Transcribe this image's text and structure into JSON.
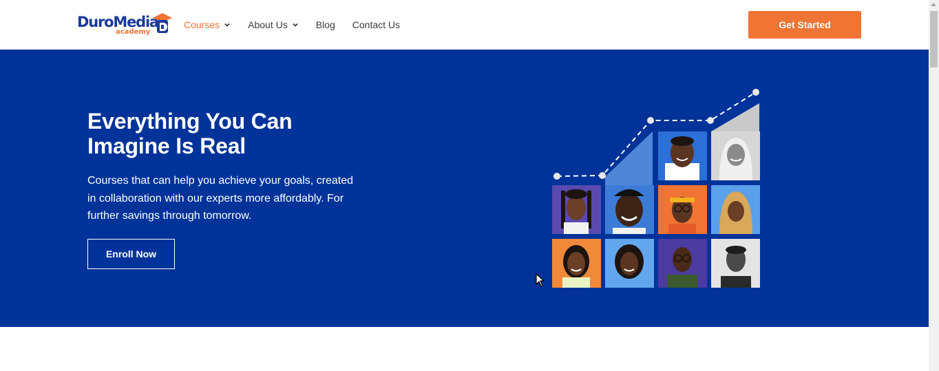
{
  "brand": {
    "name": "DuroMedia",
    "sub": "academy",
    "colors": {
      "primary": "#1c3a9c",
      "accent": "#f07434",
      "hero_bg": "#003399"
    }
  },
  "nav": {
    "items": [
      {
        "label": "Courses",
        "active": true,
        "has_dropdown": true
      },
      {
        "label": "About Us",
        "active": false,
        "has_dropdown": true
      },
      {
        "label": "Blog",
        "active": false,
        "has_dropdown": false
      },
      {
        "label": "Contact Us",
        "active": false,
        "has_dropdown": false
      }
    ],
    "cta_label": "Get Started"
  },
  "hero": {
    "title_line1": "Everything You Can",
    "title_line2": "Imagine Is Real",
    "text_line1": "Courses that can help you achieve your goals, created",
    "text_line2": "in collaboration with our experts more affordably. For",
    "text_line3": "further savings through tomorrow.",
    "button_label": "Enroll Now"
  },
  "icons": {
    "dropdown": "chevron-down-icon",
    "cursor": "mouse-pointer-icon",
    "scroll": "scrollbar-up-arrow-icon"
  }
}
